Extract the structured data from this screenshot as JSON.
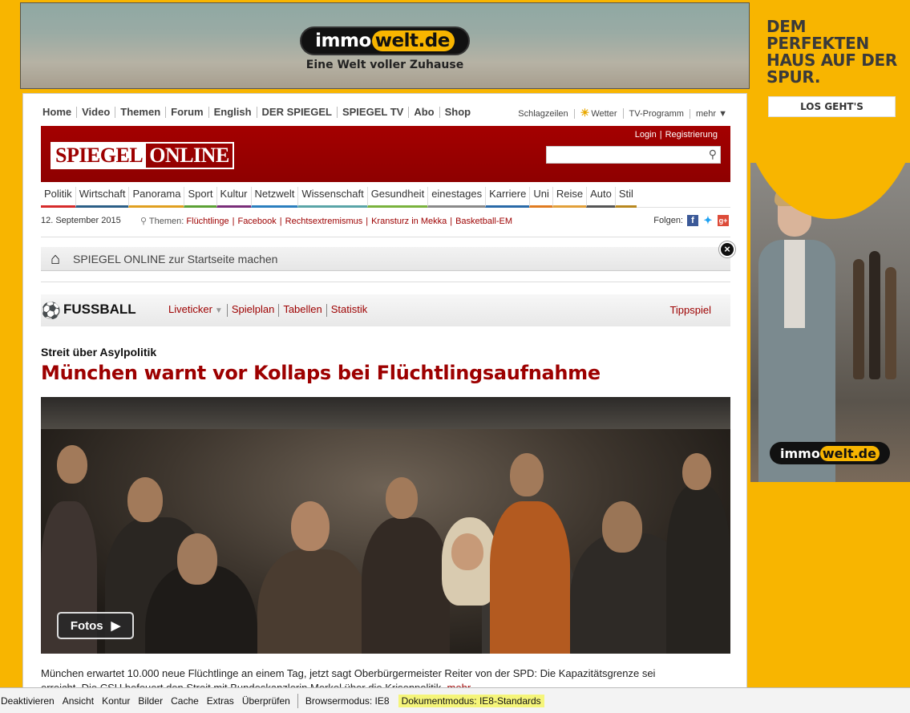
{
  "ads": {
    "top": {
      "logo_immo": "immo",
      "logo_welt": "welt.de",
      "slogan": "Eine Welt voller Zuhause"
    },
    "side": {
      "headline_lines": [
        "DEM PERFEKTEN",
        "HAUS AUF DER",
        "SPUR."
      ],
      "cta": "LOS GEHT'S",
      "logo_immo": "immo",
      "logo_welt": "welt.de"
    }
  },
  "service_nav": {
    "left": [
      "Home",
      "Video",
      "Themen",
      "Forum",
      "English",
      "DER SPIEGEL",
      "SPIEGEL TV",
      "Abo",
      "Shop"
    ],
    "right": [
      "Schlagzeilen",
      "Wetter",
      "TV-Programm",
      "mehr ▼"
    ]
  },
  "header": {
    "logo_spiegel": "SPIEGEL",
    "logo_online": "ONLINE",
    "login": "Login",
    "register": "Registrierung",
    "search_placeholder": ""
  },
  "ressorts": [
    {
      "label": "Politik",
      "color": "#d62b2b"
    },
    {
      "label": "Wirtschaft",
      "color": "#2c5f87"
    },
    {
      "label": "Panorama",
      "color": "#e0a020"
    },
    {
      "label": "Sport",
      "color": "#5ca135"
    },
    {
      "label": "Kultur",
      "color": "#7a2e7a"
    },
    {
      "label": "Netzwelt",
      "color": "#2b7fbf"
    },
    {
      "label": "Wissenschaft",
      "color": "#5aa5a8"
    },
    {
      "label": "Gesundheit",
      "color": "#7ab33d"
    },
    {
      "label": "einestages",
      "color": "#8a8a8a"
    },
    {
      "label": "Karriere",
      "color": "#2a6aa8"
    },
    {
      "label": "Uni",
      "color": "#e07b20"
    },
    {
      "label": "Reise",
      "color": "#e2a03a"
    },
    {
      "label": "Auto",
      "color": "#555555"
    },
    {
      "label": "Stil",
      "color": "#b8881f"
    }
  ],
  "themen": {
    "date": "12. September 2015",
    "label": "Themen:",
    "topics": [
      "Flüchtlinge",
      "Facebook",
      "Rechtsextremismus",
      "Kransturz in Mekka",
      "Basketball-EM"
    ],
    "follow_label": "Folgen:"
  },
  "startpage": {
    "text": "SPIEGEL ONLINE zur Startseite machen"
  },
  "fussball": {
    "title": "FUSSBALL",
    "links": [
      "Liveticker",
      "Spielplan",
      "Tabellen",
      "Statistik"
    ],
    "tippspiel": "Tippspiel"
  },
  "article": {
    "kicker": "Streit über Asylpolitik",
    "headline": "München warnt vor Kollaps bei Flüchtlingsaufnahme",
    "fotos_label": "Fotos",
    "teaser_line1": "München erwartet 10.000 neue Flüchtlinge an einem Tag, jetzt sagt Oberbürgermeister Reiter von der SPD: Die Kapazitätsgrenze sei",
    "teaser_line2": "erreicht. Die CSU befeuert den Streit mit Bundeskanzlerin Merkel über die Krisenpolitik.",
    "teaser_more": "mehr..."
  },
  "devbar": {
    "items": [
      "Deaktivieren",
      "Ansicht",
      "Kontur",
      "Bilder",
      "Cache",
      "Extras",
      "Überprüfen"
    ],
    "browser_mode": "Browsermodus: IE8",
    "document_mode": "Dokumentmodus: IE8-Standards"
  },
  "colors": {
    "brand_red": "#9d0000",
    "ad_yellow": "#f8b500",
    "highlight": "#f5f57a"
  }
}
